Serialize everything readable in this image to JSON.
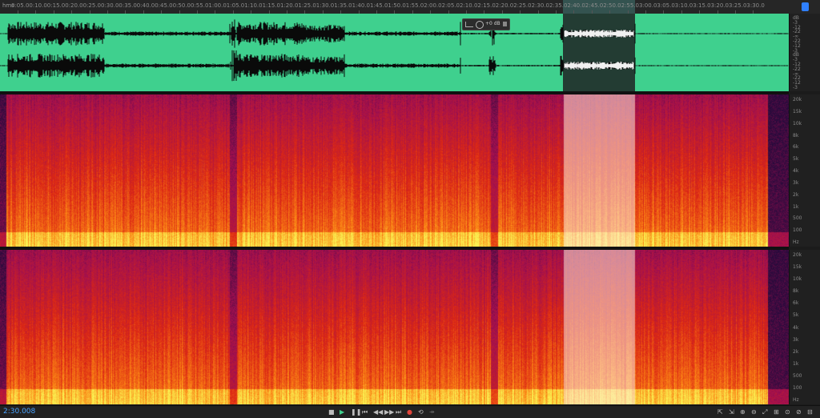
{
  "ruler": {
    "unit": "hms",
    "labels": [
      "0:05.0",
      "0:10.0",
      "0:15.0",
      "0:20.0",
      "0:25.0",
      "0:30.0",
      "0:35.0",
      "0:40.0",
      "0:45.0",
      "0:50.0",
      "0:55.0",
      "1:00.0",
      "1:05.0",
      "1:10.0",
      "1:15.0",
      "1:20.0",
      "1:25.0",
      "1:30.0",
      "1:35.0",
      "1:40.0",
      "1:45.0",
      "1:50.0",
      "1:55.0",
      "2:00.0",
      "2:05.0",
      "2:10.0",
      "2:15.0",
      "2:20.0",
      "2:25.0",
      "2:30.0",
      "2:35.0",
      "2:40.0",
      "2:45.0",
      "2:50.0",
      "2:55.0",
      "3:00.0",
      "3:05.0",
      "3:10.0",
      "3:15.0",
      "3:20.0",
      "3:25.0",
      "3:30.0"
    ]
  },
  "hud": {
    "volume": "+0 dB"
  },
  "waveform_scale": [
    "dB",
    "-3",
    "-12",
    "-22",
    "-∞",
    "-22",
    "-12",
    "-3",
    "dB",
    "-3",
    "-12",
    "-22",
    "-∞",
    "-22",
    "-12",
    "-3"
  ],
  "spectral_scale": [
    "20k",
    "15k",
    "10k",
    "8k",
    "6k",
    "5k",
    "4k",
    "3k",
    "2k",
    "1k",
    "500",
    "100",
    "Hz"
  ],
  "transport": {
    "time": "2:30.008",
    "buttons": [
      "stop",
      "play",
      "pause",
      "go-to-start",
      "rewind",
      "fast-forward",
      "go-to-end",
      "record",
      "loop",
      "skip-selection"
    ]
  },
  "colors": {
    "waveform_bg": "#3fd08e",
    "waveform_fg": "#0a0a0a",
    "selection": "#233c33",
    "time_text": "#4aa3ff"
  }
}
